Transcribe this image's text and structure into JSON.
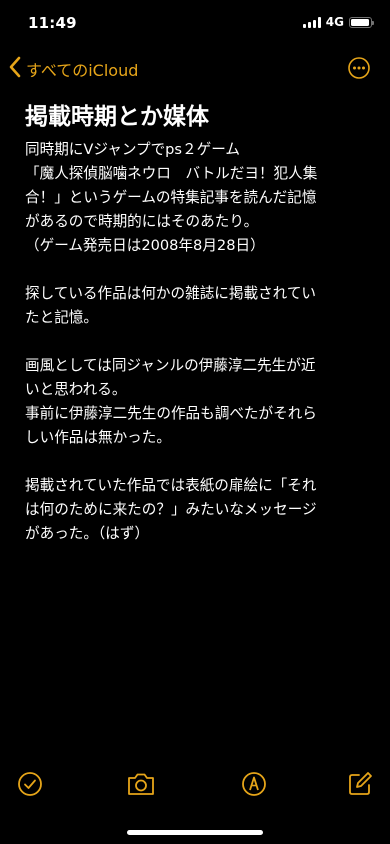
{
  "status_bar": {
    "time": "11:49",
    "network": "4G",
    "battery_level": 0.95
  },
  "nav": {
    "back_label": "すべてのiCloud",
    "more_icon": "ellipsis-circle-icon"
  },
  "note": {
    "title": "掲載時期とか媒体",
    "lines": [
      "同時期にVジャンプでps２ゲーム",
      "「魔人探偵脳噛ネウロ　バトルだヨ！犯人集",
      "合！」というゲームの特集記事を読んだ記憶",
      "があるので時期的にはそのあたり。",
      "（ゲーム発売日は2008年8月28日）",
      "",
      "探している作品は何かの雑誌に掲載されてい",
      "たと記憶。",
      "",
      "画風としては同ジャンルの伊藤淳二先生が近",
      "いと思われる。",
      "事前に伊藤淳二先生の作品も調べたがそれら",
      "しい作品は無かった。",
      "",
      "掲載されていた作品では表紙の扉絵に「それ",
      "は何のために来たの？」みたいなメッセージ",
      "があった。（はず）"
    ]
  },
  "toolbar": {
    "items": [
      "checklist-icon",
      "camera-icon",
      "markup-icon",
      "compose-icon"
    ]
  },
  "colors": {
    "background": "#000000",
    "text": "#ffffff",
    "accent": "#e6a519"
  }
}
